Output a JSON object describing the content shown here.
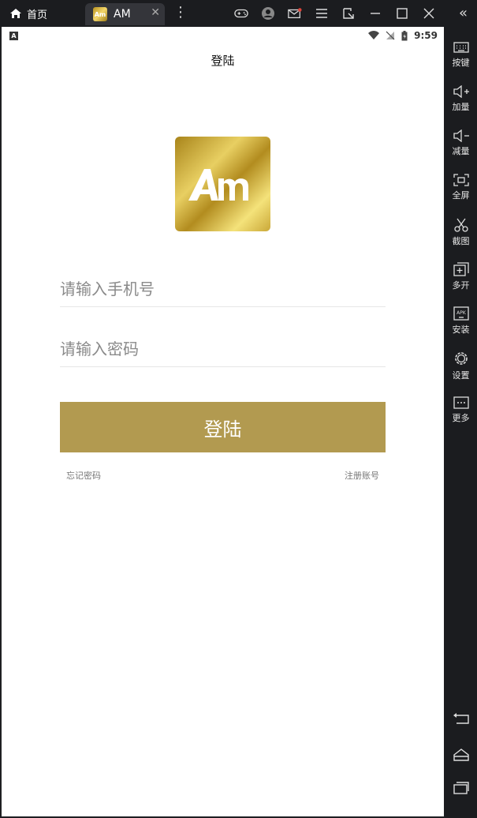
{
  "window": {
    "home_tab": "首页",
    "app_tab": "AM",
    "tab_logo_text": "Am"
  },
  "statusbar": {
    "indicator": "A",
    "time": "9:59"
  },
  "page": {
    "title": "登陆",
    "logo_text": "Am"
  },
  "form": {
    "phone_placeholder": "请输入手机号",
    "phone_value": "",
    "password_placeholder": "请输入密码",
    "password_value": "",
    "login_label": "登陆",
    "forgot_label": "忘记密码",
    "register_label": "注册账号"
  },
  "sidebar": {
    "items": [
      {
        "label": "按键",
        "icon": "keyboard-icon"
      },
      {
        "label": "加量",
        "icon": "volume-up-icon"
      },
      {
        "label": "减量",
        "icon": "volume-down-icon"
      },
      {
        "label": "全屏",
        "icon": "fullscreen-icon"
      },
      {
        "label": "截图",
        "icon": "scissors-icon"
      },
      {
        "label": "多开",
        "icon": "multi-instance-icon"
      },
      {
        "label": "安装",
        "icon": "apk-icon"
      },
      {
        "label": "设置",
        "icon": "gear-icon"
      },
      {
        "label": "更多",
        "icon": "more-icon"
      }
    ]
  },
  "colors": {
    "brand_gold": "#b29a50",
    "background": "#ffffff",
    "chrome": "#1b1c1f"
  }
}
